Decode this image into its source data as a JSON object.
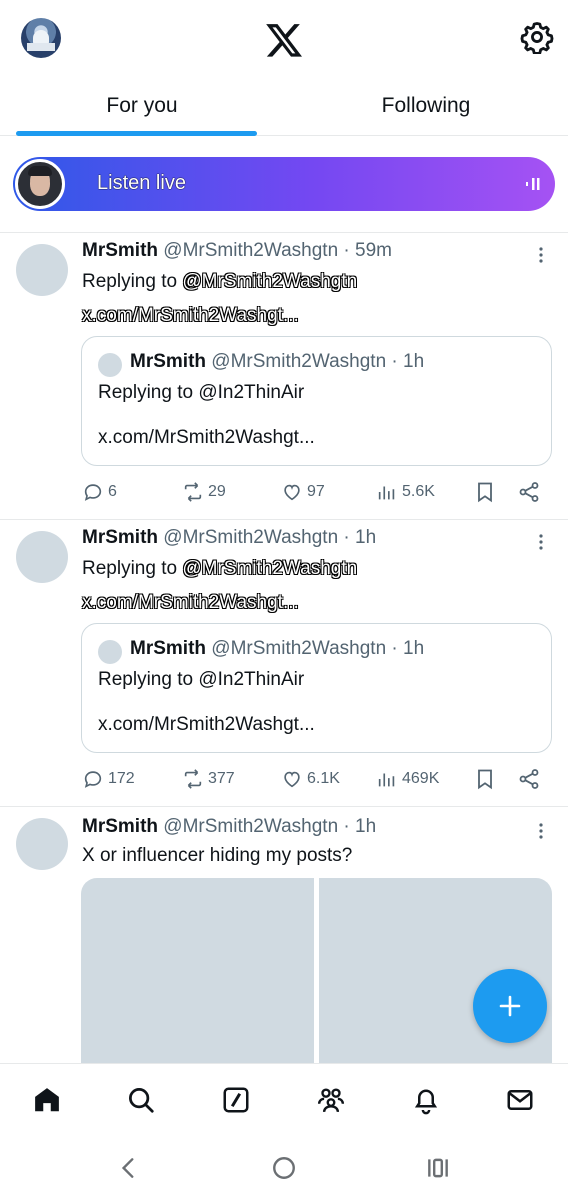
{
  "app": {
    "logo": "x-logo",
    "settings_icon": "gear-icon"
  },
  "tabs": [
    {
      "label": "For you",
      "active": true
    },
    {
      "label": "Following",
      "active": false
    }
  ],
  "listen_live": {
    "label": "Listen live",
    "icon": "audio-bars-icon"
  },
  "posts": [
    {
      "name": "MrSmith",
      "handle": "@MrSmith2Washgtn",
      "time": "· 59m",
      "reply_prefix": "Replying to ",
      "reply_handle": "@MrSmith2Washgtn",
      "link": "x.com/MrSmith2Washgt...",
      "quote": {
        "name": "MrSmith",
        "handle": "@MrSmith2Washgtn",
        "time": "· 1h",
        "reply_text": "Replying to @In2ThinAir",
        "link": "x.com/MrSmith2Washgt..."
      },
      "replies": "6",
      "reposts": "29",
      "likes": "97",
      "views": "5.6K"
    },
    {
      "name": "MrSmith",
      "handle": "@MrSmith2Washgtn",
      "time": "· 1h",
      "reply_prefix": "Replying to ",
      "reply_handle": "@MrSmith2Washgtn",
      "link": "x.com/MrSmith2Washgt...",
      "quote": {
        "name": "MrSmith",
        "handle": "@MrSmith2Washgtn",
        "time": "· 1h",
        "reply_text": "Replying to @In2ThinAir",
        "link": "x.com/MrSmith2Washgt..."
      },
      "replies": "172",
      "reposts": "377",
      "likes": "6.1K",
      "views": "469K"
    },
    {
      "name": "MrSmith",
      "handle": "@MrSmith2Washgtn",
      "time": "· 1h",
      "text": "X or influencer hiding my posts?"
    }
  ],
  "bottom_nav": [
    "home-icon",
    "search-icon",
    "grok-icon",
    "communities-icon",
    "notifications-icon",
    "messages-icon"
  ],
  "system_nav": [
    "back-icon",
    "home-circle-icon",
    "recents-icon"
  ]
}
